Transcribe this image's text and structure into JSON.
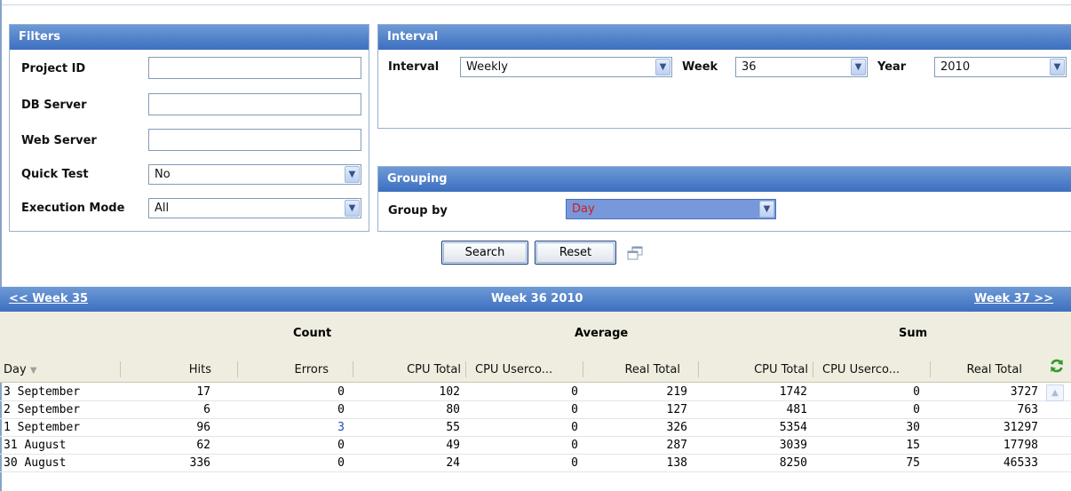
{
  "filters": {
    "title": "Filters",
    "project_id_label": "Project ID",
    "project_id_value": "",
    "db_server_label": "DB Server",
    "db_server_value": "",
    "web_server_label": "Web Server",
    "web_server_value": "",
    "quick_test_label": "Quick Test",
    "quick_test_value": "No",
    "execution_mode_label": "Execution Mode",
    "execution_mode_value": "All"
  },
  "interval": {
    "title": "Interval",
    "interval_label": "Interval",
    "interval_value": "Weekly",
    "week_label": "Week",
    "week_value": "36",
    "year_label": "Year",
    "year_value": "2010"
  },
  "grouping": {
    "title": "Grouping",
    "group_by_label": "Group by",
    "group_by_value": "Day"
  },
  "actions": {
    "search_label": "Search",
    "reset_label": "Reset"
  },
  "week_nav": {
    "prev": "<< Week 35",
    "current": "Week 36 2010",
    "next": "Week 37 >>"
  },
  "groups": {
    "count": "Count",
    "average": "Average",
    "sum": "Sum"
  },
  "columns": [
    "Day",
    "Hits",
    "Errors",
    "CPU Total",
    "CPU Userco...",
    "Real Total",
    "CPU Total",
    "CPU Userco...",
    "Real Total"
  ],
  "rows": [
    [
      "3 September",
      "17",
      "0",
      "102",
      "0",
      "219",
      "1742",
      "0",
      "3727"
    ],
    [
      "2 September",
      "6",
      "0",
      "80",
      "0",
      "127",
      "481",
      "0",
      "763"
    ],
    [
      "1 September",
      "96",
      "3",
      "55",
      "0",
      "326",
      "5354",
      "30",
      "31297"
    ],
    [
      "31 August",
      "62",
      "0",
      "49",
      "0",
      "287",
      "3039",
      "15",
      "17798"
    ],
    [
      "30 August",
      "336",
      "0",
      "24",
      "0",
      "138",
      "8250",
      "75",
      "46533"
    ]
  ],
  "colors": {
    "header_blue": "#3c6fbf",
    "group_by_highlight": "#7898dc",
    "group_by_text": "#d01c1c",
    "error_link": "#1a4dbd"
  },
  "icons": {
    "dropdown": "chevron-down-icon",
    "refresh": "refresh-icon",
    "popout": "popout-icon",
    "sort": "sort-desc-icon"
  }
}
